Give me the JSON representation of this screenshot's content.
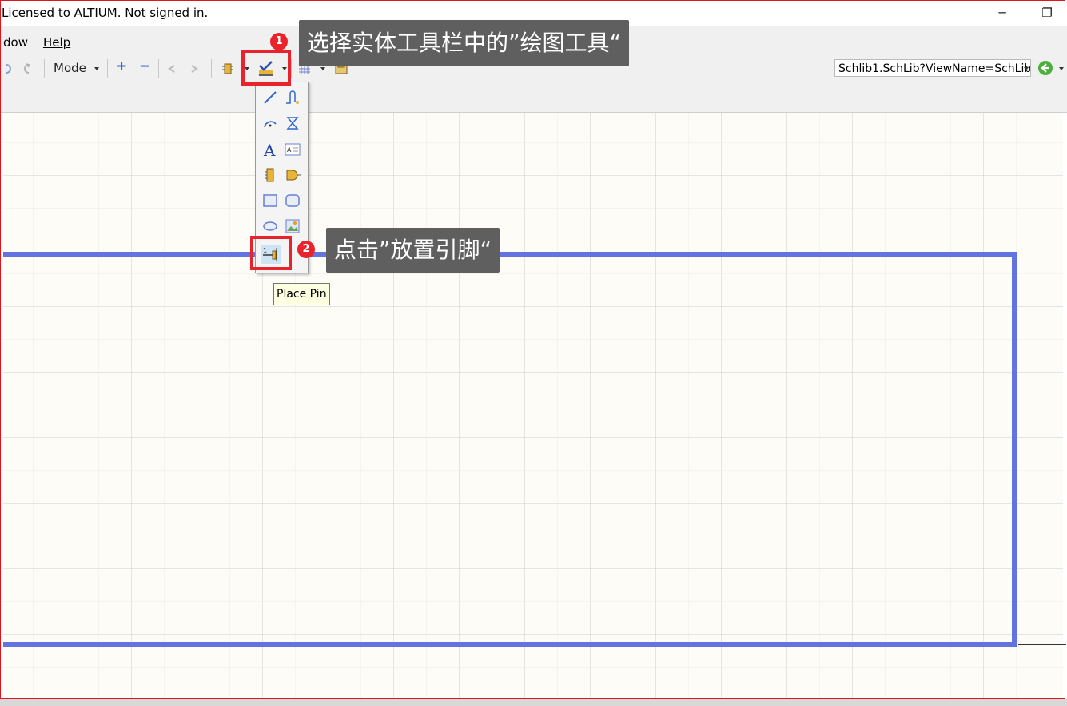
{
  "titlebar": {
    "license_text": "Licensed to ALTIUM. Not signed in.",
    "restore_glyph": "❐",
    "minimize_glyph": "─"
  },
  "menu": {
    "window_label": "dow",
    "help_label": "Help"
  },
  "toolbar": {
    "mode_label": "Mode",
    "plus_glyph": "+",
    "minus_glyph": "−"
  },
  "address": {
    "value": "Schlib1.SchLib?ViewName=SchLib"
  },
  "tooltip": {
    "text": "Place Pin"
  },
  "callouts": [
    {
      "number": "1",
      "text": "选择实体工具栏中的”绘图工具“"
    },
    {
      "number": "2",
      "text": "点击”放置引脚“"
    }
  ],
  "colors": {
    "highlight": "#e8232b",
    "schematic_box": "#6373e0",
    "callout_bg": "#5f5f5f"
  }
}
